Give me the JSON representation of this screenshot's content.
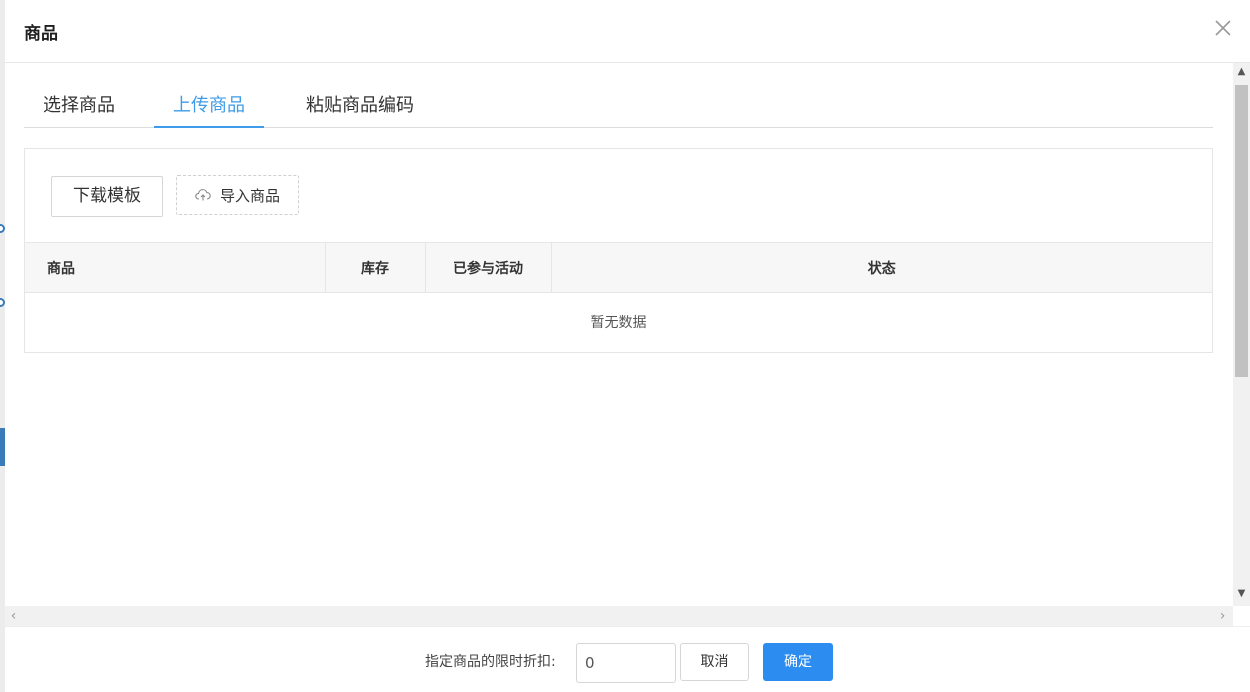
{
  "dialog": {
    "title": "商品"
  },
  "tabs": [
    {
      "label": "选择商品",
      "active": false
    },
    {
      "label": "上传商品",
      "active": true
    },
    {
      "label": "粘贴商品编码",
      "active": false
    }
  ],
  "toolbar": {
    "download_label": "下载模板",
    "import_label": "导入商品"
  },
  "table": {
    "columns": [
      "商品",
      "库存",
      "已参与活动",
      "状态"
    ],
    "empty_text": "暂无数据"
  },
  "footer": {
    "discount_label": "指定商品的限时折扣:",
    "discount_value": "0",
    "cancel_label": "取消",
    "confirm_label": "确定"
  },
  "colors": {
    "accent": "#3d9be9",
    "primary_button": "#2d8cf0"
  },
  "icons": {
    "close": "close-icon",
    "upload": "cloud-upload-icon"
  }
}
